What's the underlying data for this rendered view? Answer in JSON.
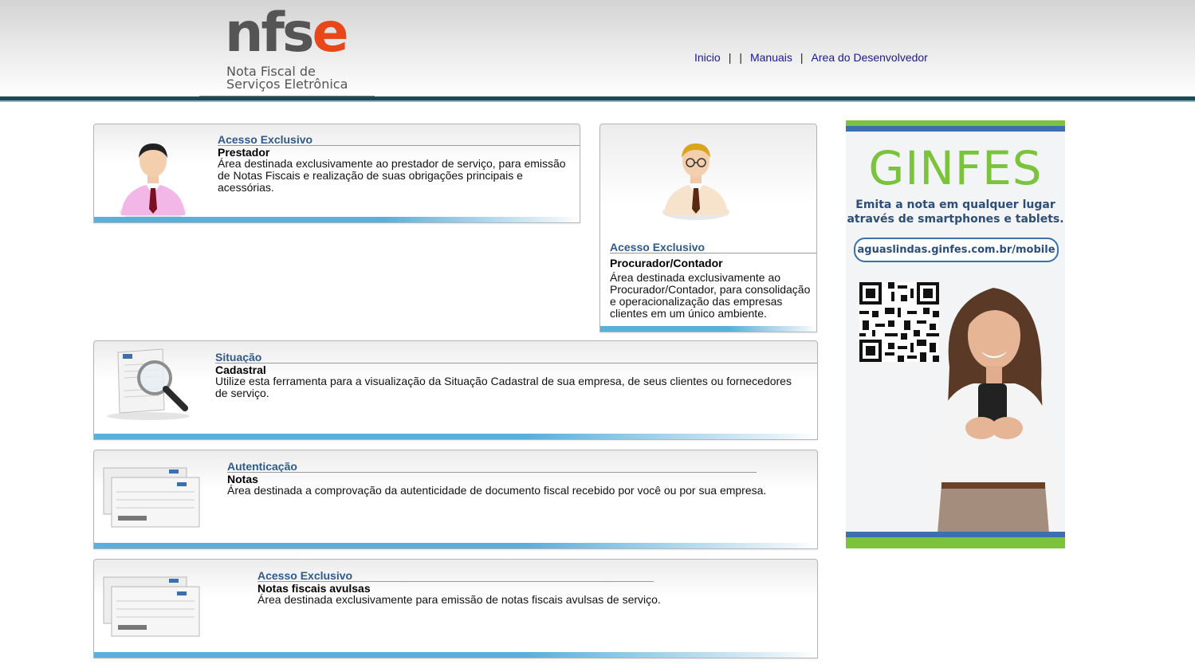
{
  "header": {
    "logo": {
      "word_main": "nfs",
      "word_accent": "e",
      "subtitle_line1": "Nota Fiscal de",
      "subtitle_line2": "Serviços Eletrônica"
    },
    "nav": {
      "items": [
        "Inicio",
        "Manuais",
        "Area do Desenvolvedor"
      ],
      "separator": "|"
    }
  },
  "cards": {
    "prestador": {
      "kicker": "Acesso Exclusivo",
      "title": "Prestador",
      "description": "Área destinada exclusivamente ao prestador de serviço, para emissão de Notas Fiscais e realização de suas obrigações principais e acessórias.",
      "icon": "person-pink-shirt-icon"
    },
    "procurador": {
      "kicker": "Acesso Exclusivo",
      "title": "Procurador/Contador",
      "description": "Área destinada exclusivamente ao Procurador/Contador, para consolidação e operacionalização das empresas clientes em um único ambiente.",
      "icon": "person-glasses-icon"
    },
    "situacao": {
      "kicker": "Situação",
      "title": "Cadastral",
      "description": "Utilize esta ferramenta para a visualização da Situação Cadastral de sua empresa, de seus clientes ou fornecedores de serviço.",
      "icon": "document-magnifier-icon"
    },
    "autenticacao": {
      "kicker": "Autenticação",
      "title": "Notas",
      "description": "Área destinada a comprovação da autenticidade de documento fiscal recebido por você ou por sua empresa.",
      "icon": "stacked-documents-icon"
    },
    "avulsas": {
      "kicker": "Acesso Exclusivo",
      "title": "Notas fiscais avulsas",
      "description": "Área destinada exclusivamente para emissão de notas fiscais avulsas de serviço.",
      "icon": "stacked-documents-icon"
    }
  },
  "banner": {
    "logo_text": "GINFES",
    "tagline_line1": "Emita a nota em qualquer lugar",
    "tagline_line2": "através de smartphones e tablets.",
    "url": "aguaslindas.ginfes.com.br/mobile",
    "icons": [
      "qr-code-icon",
      "woman-with-phone-icon"
    ],
    "colors": {
      "green": "#7ac33a",
      "blue": "#3a6fb0"
    }
  },
  "colors": {
    "header_bar": "#1a4a55",
    "card_strip": "#5ab0dc",
    "kicker_text": "#2f5a8c",
    "nav_link": "#1a1a8c",
    "logo_accent": "#e8471a"
  }
}
